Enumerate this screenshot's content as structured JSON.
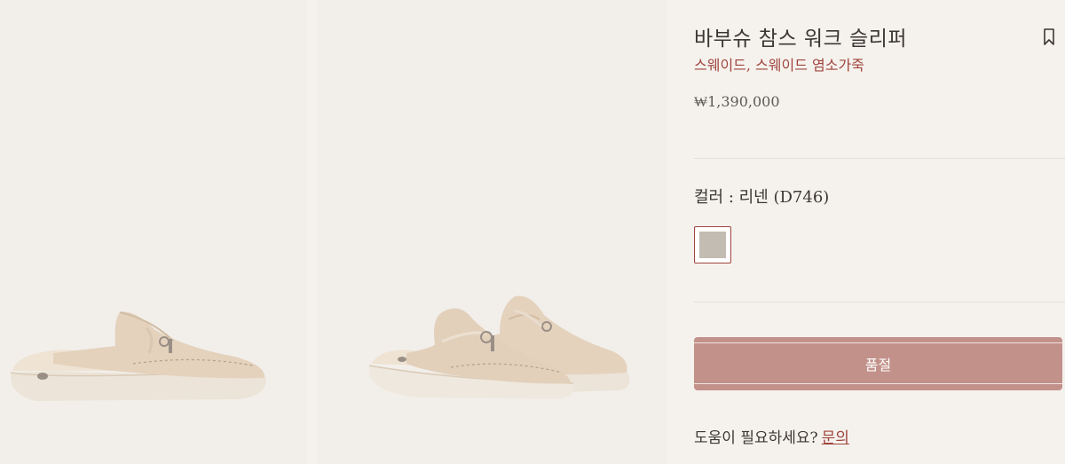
{
  "product": {
    "title": "바부슈 참스 워크 슬리퍼",
    "material": "스웨이드, 스웨이드 염소가죽",
    "price": "₩1,390,000"
  },
  "color": {
    "label": "컬러 : 리넨 (D746)",
    "swatch_hex": "#c2bcb3"
  },
  "actions": {
    "soldout_label": "품절",
    "help_text": "도움이 필요하세요?",
    "help_link": "문의"
  },
  "icons": {
    "bookmark": "bookmark-icon"
  },
  "colors": {
    "accent": "#a0443c",
    "button": "#c2918a",
    "background": "#f5f2ee",
    "shoe": "#e6d5c2"
  }
}
